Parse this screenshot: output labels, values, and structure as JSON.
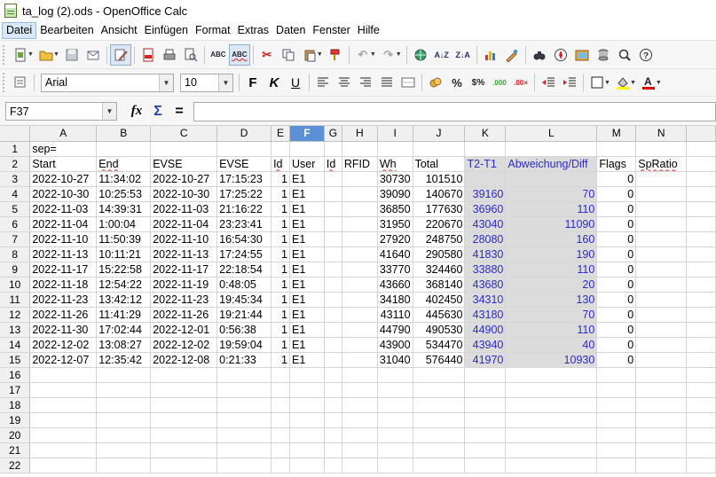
{
  "window": {
    "title": "ta_log (2).ods - OpenOffice Calc"
  },
  "menu": [
    "Datei",
    "Bearbeiten",
    "Ansicht",
    "Einfügen",
    "Format",
    "Extras",
    "Daten",
    "Fenster",
    "Hilfe"
  ],
  "toolbar_format": {
    "font_name": "Arial",
    "font_size": "10"
  },
  "formula": {
    "name_box": "F37",
    "content": ""
  },
  "icons": {
    "standard": [
      "new-document-icon",
      "open-folder-icon",
      "save-icon",
      "email-icon",
      "edit-mode-icon",
      "export-pdf-icon",
      "print-icon",
      "page-preview-icon",
      "spellcheck-icon",
      "autospellcheck-icon",
      "cut-icon",
      "copy-icon",
      "paste-icon",
      "format-paintbrush-icon",
      "undo-icon",
      "redo-icon",
      "hyperlink-icon",
      "sort-ascending-icon",
      "sort-descending-icon",
      "chart-icon",
      "draw-functions-icon",
      "find-binoculars-icon",
      "navigator-icon",
      "gallery-icon",
      "datasources-icon",
      "zoom-icon",
      "help-icon"
    ],
    "format": [
      "styles-icon",
      "bold-icon",
      "italic-icon",
      "underline-icon",
      "align-left-icon",
      "align-center-icon",
      "align-right-icon",
      "justify-icon",
      "merge-cells-icon",
      "currency-icon",
      "percent-icon",
      "standard-number-icon",
      "add-decimal-icon",
      "delete-decimal-icon",
      "decrease-indent-icon",
      "increase-indent-icon",
      "borders-icon",
      "background-color-icon",
      "font-color-icon"
    ]
  },
  "colors": {
    "selected_column_header": "#5b8fd6",
    "calc_text": "#2b2bd0",
    "calc_fill": "#dcdcdc"
  },
  "grid": {
    "selected_column": "F",
    "columns": [
      "A",
      "B",
      "C",
      "D",
      "E",
      "F",
      "G",
      "H",
      "I",
      "J",
      "K",
      "L",
      "M",
      "N"
    ],
    "rows": [
      {
        "n": "1",
        "A": "sep=",
        "B": "",
        "C": "",
        "D": "",
        "E": "",
        "F": "",
        "G": "",
        "H": "",
        "I": "",
        "J": "",
        "K": "",
        "L": "",
        "M": "",
        "N": ""
      },
      {
        "n": "2",
        "A": "Start",
        "B": "End",
        "C": "EVSE",
        "D": "EVSE",
        "E": "Id",
        "F": "User",
        "G": "Id",
        "H": "RFID",
        "I": "Wh",
        "J": "Total",
        "K": "T2-T1",
        "L": "Abweichung/Diff",
        "M": "Flags",
        "N": "SpRatio"
      },
      {
        "n": "3",
        "A": "2022-10-27",
        "B": "11:34:02",
        "C": "2022-10-27",
        "D": "17:15:23",
        "E": "1",
        "F": "E1",
        "G": "",
        "H": "",
        "I": "30730",
        "J": "101510",
        "K": "",
        "L": "",
        "M": "0",
        "N": ""
      },
      {
        "n": "4",
        "A": "2022-10-30",
        "B": "10:25:53",
        "C": "2022-10-30",
        "D": "17:25:22",
        "E": "1",
        "F": "E1",
        "G": "",
        "H": "",
        "I": "39090",
        "J": "140670",
        "K": "39160",
        "L": "70",
        "M": "0",
        "N": ""
      },
      {
        "n": "5",
        "A": "2022-11-03",
        "B": "14:39:31",
        "C": "2022-11-03",
        "D": "21:16:22",
        "E": "1",
        "F": "E1",
        "G": "",
        "H": "",
        "I": "36850",
        "J": "177630",
        "K": "36960",
        "L": "110",
        "M": "0",
        "N": ""
      },
      {
        "n": "6",
        "A": "2022-11-04",
        "B": "1:00:04",
        "C": "2022-11-04",
        "D": "23:23:41",
        "E": "1",
        "F": "E1",
        "G": "",
        "H": "",
        "I": "31950",
        "J": "220670",
        "K": "43040",
        "L": "11090",
        "M": "0",
        "N": ""
      },
      {
        "n": "7",
        "A": "2022-11-10",
        "B": "11:50:39",
        "C": "2022-11-10",
        "D": "16:54:30",
        "E": "1",
        "F": "E1",
        "G": "",
        "H": "",
        "I": "27920",
        "J": "248750",
        "K": "28080",
        "L": "160",
        "M": "0",
        "N": ""
      },
      {
        "n": "8",
        "A": "2022-11-13",
        "B": "10:11:21",
        "C": "2022-11-13",
        "D": "17:24:55",
        "E": "1",
        "F": "E1",
        "G": "",
        "H": "",
        "I": "41640",
        "J": "290580",
        "K": "41830",
        "L": "190",
        "M": "0",
        "N": ""
      },
      {
        "n": "9",
        "A": "2022-11-17",
        "B": "15:22:58",
        "C": "2022-11-17",
        "D": "22:18:54",
        "E": "1",
        "F": "E1",
        "G": "",
        "H": "",
        "I": "33770",
        "J": "324460",
        "K": "33880",
        "L": "110",
        "M": "0",
        "N": ""
      },
      {
        "n": "10",
        "A": "2022-11-18",
        "B": "12:54:22",
        "C": "2022-11-19",
        "D": "0:48:05",
        "E": "1",
        "F": "E1",
        "G": "",
        "H": "",
        "I": "43660",
        "J": "368140",
        "K": "43680",
        "L": "20",
        "M": "0",
        "N": ""
      },
      {
        "n": "11",
        "A": "2022-11-23",
        "B": "13:42:12",
        "C": "2022-11-23",
        "D": "19:45:34",
        "E": "1",
        "F": "E1",
        "G": "",
        "H": "",
        "I": "34180",
        "J": "402450",
        "K": "34310",
        "L": "130",
        "M": "0",
        "N": ""
      },
      {
        "n": "12",
        "A": "2022-11-26",
        "B": "11:41:29",
        "C": "2022-11-26",
        "D": "19:21:44",
        "E": "1",
        "F": "E1",
        "G": "",
        "H": "",
        "I": "43110",
        "J": "445630",
        "K": "43180",
        "L": "70",
        "M": "0",
        "N": ""
      },
      {
        "n": "13",
        "A": "2022-11-30",
        "B": "17:02:44",
        "C": "2022-12-01",
        "D": "0:56:38",
        "E": "1",
        "F": "E1",
        "G": "",
        "H": "",
        "I": "44790",
        "J": "490530",
        "K": "44900",
        "L": "110",
        "M": "0",
        "N": ""
      },
      {
        "n": "14",
        "A": "2022-12-02",
        "B": "13:08:27",
        "C": "2022-12-02",
        "D": "19:59:04",
        "E": "1",
        "F": "E1",
        "G": "",
        "H": "",
        "I": "43900",
        "J": "534470",
        "K": "43940",
        "L": "40",
        "M": "0",
        "N": ""
      },
      {
        "n": "15",
        "A": "2022-12-07",
        "B": "12:35:42",
        "C": "2022-12-08",
        "D": "0:21:33",
        "E": "1",
        "F": "E1",
        "G": "",
        "H": "",
        "I": "31040",
        "J": "576440",
        "K": "41970",
        "L": "10930",
        "M": "0",
        "N": ""
      },
      {
        "n": "16",
        "A": "",
        "B": "",
        "C": "",
        "D": "",
        "E": "",
        "F": "",
        "G": "",
        "H": "",
        "I": "",
        "J": "",
        "K": "",
        "L": "",
        "M": "",
        "N": ""
      },
      {
        "n": "17",
        "A": "",
        "B": "",
        "C": "",
        "D": "",
        "E": "",
        "F": "",
        "G": "",
        "H": "",
        "I": "",
        "J": "",
        "K": "",
        "L": "",
        "M": "",
        "N": ""
      },
      {
        "n": "18",
        "A": "",
        "B": "",
        "C": "",
        "D": "",
        "E": "",
        "F": "",
        "G": "",
        "H": "",
        "I": "",
        "J": "",
        "K": "",
        "L": "",
        "M": "",
        "N": ""
      },
      {
        "n": "19",
        "A": "",
        "B": "",
        "C": "",
        "D": "",
        "E": "",
        "F": "",
        "G": "",
        "H": "",
        "I": "",
        "J": "",
        "K": "",
        "L": "",
        "M": "",
        "N": ""
      },
      {
        "n": "20",
        "A": "",
        "B": "",
        "C": "",
        "D": "",
        "E": "",
        "F": "",
        "G": "",
        "H": "",
        "I": "",
        "J": "",
        "K": "",
        "L": "",
        "M": "",
        "N": ""
      },
      {
        "n": "21",
        "A": "",
        "B": "",
        "C": "",
        "D": "",
        "E": "",
        "F": "",
        "G": "",
        "H": "",
        "I": "",
        "J": "",
        "K": "",
        "L": "",
        "M": "",
        "N": ""
      },
      {
        "n": "22",
        "A": "",
        "B": "",
        "C": "",
        "D": "",
        "E": "",
        "F": "",
        "G": "",
        "H": "",
        "I": "",
        "J": "",
        "K": "",
        "L": "",
        "M": "",
        "N": ""
      }
    ]
  }
}
